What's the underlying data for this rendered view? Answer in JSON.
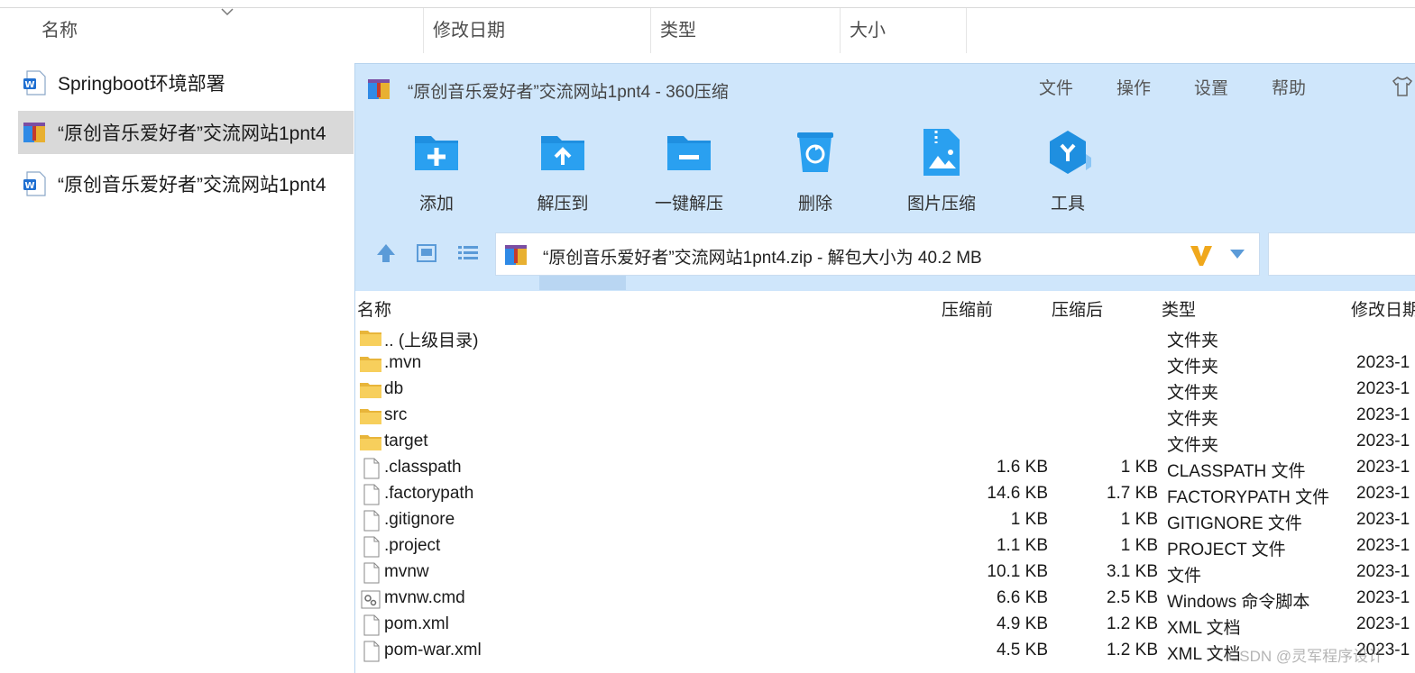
{
  "explorer": {
    "columns": [
      "名称",
      "修改日期",
      "类型",
      "大小"
    ],
    "items": [
      {
        "name": "Springboot环境部署",
        "icon": "word-doc-icon",
        "selected": false
      },
      {
        "name": "“原创音乐爱好者”交流网站1pnt4",
        "icon": "zip-archive-icon",
        "selected": true
      },
      {
        "name": "“原创音乐爱好者”交流网站1pnt4",
        "icon": "word-doc-icon",
        "selected": false
      }
    ]
  },
  "zip": {
    "title": "“原创音乐爱好者”交流网站1pnt4 - 360压缩",
    "menu": [
      "文件",
      "操作",
      "设置",
      "帮助"
    ],
    "toolbar": [
      "添加",
      "解压到",
      "一键解压",
      "删除",
      "图片压缩",
      "工具"
    ],
    "address": "“原创音乐爱好者”交流网站1pnt4.zip - 解包大小为 40.2 MB",
    "columns": {
      "name": "名称",
      "before": "压缩前",
      "after": "压缩后",
      "type": "类型",
      "date": "修改日期"
    },
    "rows": [
      {
        "name": ".. (上级目录)",
        "before": "",
        "after": "",
        "type": "文件夹",
        "date": "",
        "icon": "folder-icon"
      },
      {
        "name": ".mvn",
        "before": "",
        "after": "",
        "type": "文件夹",
        "date": "2023-1",
        "icon": "folder-icon"
      },
      {
        "name": "db",
        "before": "",
        "after": "",
        "type": "文件夹",
        "date": "2023-1",
        "icon": "folder-icon"
      },
      {
        "name": "src",
        "before": "",
        "after": "",
        "type": "文件夹",
        "date": "2023-1",
        "icon": "folder-icon"
      },
      {
        "name": "target",
        "before": "",
        "after": "",
        "type": "文件夹",
        "date": "2023-1",
        "icon": "folder-icon"
      },
      {
        "name": ".classpath",
        "before": "1.6 KB",
        "after": "1 KB",
        "type": "CLASSPATH 文件",
        "date": "2023-1",
        "icon": "file-icon"
      },
      {
        "name": ".factorypath",
        "before": "14.6 KB",
        "after": "1.7 KB",
        "type": "FACTORYPATH 文件",
        "date": "2023-1",
        "icon": "file-icon"
      },
      {
        "name": ".gitignore",
        "before": "1 KB",
        "after": "1 KB",
        "type": "GITIGNORE 文件",
        "date": "2023-1",
        "icon": "file-icon"
      },
      {
        "name": ".project",
        "before": "1.1 KB",
        "after": "1 KB",
        "type": "PROJECT 文件",
        "date": "2023-1",
        "icon": "file-icon"
      },
      {
        "name": "mvnw",
        "before": "10.1 KB",
        "after": "3.1 KB",
        "type": "文件",
        "date": "2023-1",
        "icon": "file-icon"
      },
      {
        "name": "mvnw.cmd",
        "before": "6.6 KB",
        "after": "2.5 KB",
        "type": "Windows 命令脚本",
        "date": "2023-1",
        "icon": "cmd-script-icon"
      },
      {
        "name": "pom.xml",
        "before": "4.9 KB",
        "after": "1.2 KB",
        "type": "XML 文档",
        "date": "2023-1",
        "icon": "file-icon"
      },
      {
        "name": "pom-war.xml",
        "before": "4.5 KB",
        "after": "1.2 KB",
        "type": "XML 文档",
        "date": "2023-1",
        "icon": "file-icon"
      }
    ]
  },
  "watermark": "CSDN @灵军程序设计",
  "colors": {
    "window_bg": "#cfe6fb",
    "accent_blue": "#1f8fe0",
    "selection": "#d9d9d9",
    "folder": "#f5c542"
  }
}
